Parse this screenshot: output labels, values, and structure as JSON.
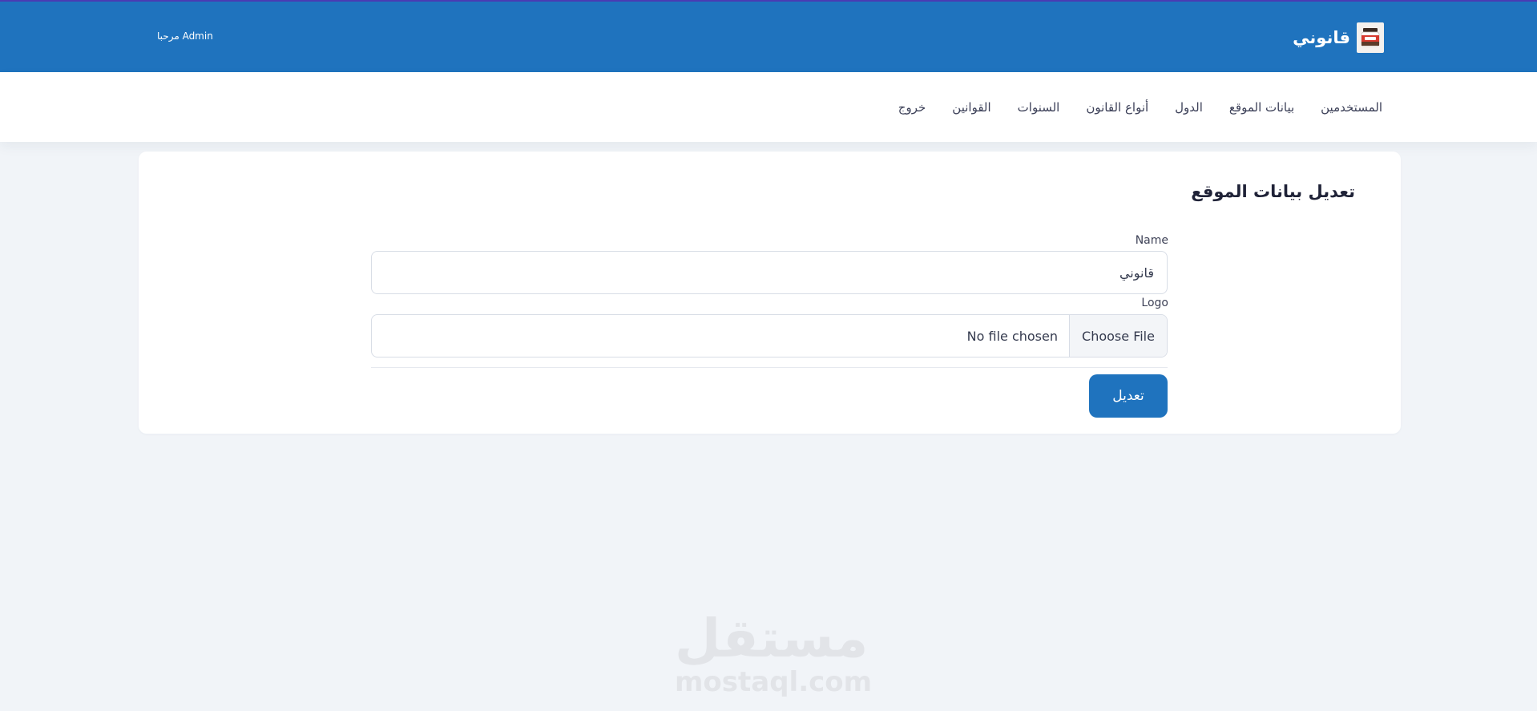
{
  "header": {
    "site_name": "قانوني",
    "logo_icon": "jar-logo-icon",
    "welcome_text": "مرحبا Admin",
    "accent_color": "#1f73be"
  },
  "nav": {
    "items": [
      {
        "label": "المستخدمين"
      },
      {
        "label": "بيانات الموقع"
      },
      {
        "label": "الدول"
      },
      {
        "label": "أنواع القانون"
      },
      {
        "label": "السنوات"
      },
      {
        "label": "القوانين"
      },
      {
        "label": "خروج"
      }
    ]
  },
  "form": {
    "title": "تعديل بيانات الموقع",
    "name_label": "Name",
    "name_value": "قانوني",
    "logo_label": "Logo",
    "file_button_label": "Choose File",
    "file_status": "No file chosen",
    "submit_label": "تعديل"
  },
  "watermark": {
    "logo_text": "مستقل",
    "site_text": "mostaql.com"
  }
}
